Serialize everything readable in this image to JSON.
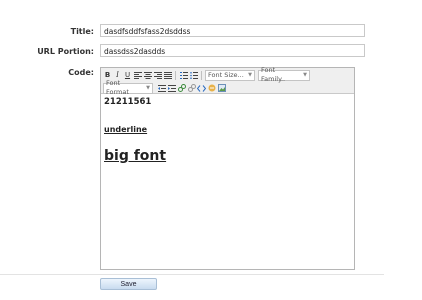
{
  "form": {
    "title_label": "Title:",
    "title_value": "dasdfsddfsfass2dsddss",
    "url_label": "URL Portion:",
    "url_value": "dassdss2dasdds",
    "code_label": "Code:"
  },
  "toolbar": {
    "bold": "B",
    "italic": "I",
    "underline": "U",
    "font_size": "Font Size...",
    "font_family": "Font Family..",
    "font_format": "Font Format"
  },
  "editor": {
    "line1": "21211561",
    "line2": "underline",
    "line3": "big font"
  },
  "actions": {
    "save_label": "Save"
  }
}
